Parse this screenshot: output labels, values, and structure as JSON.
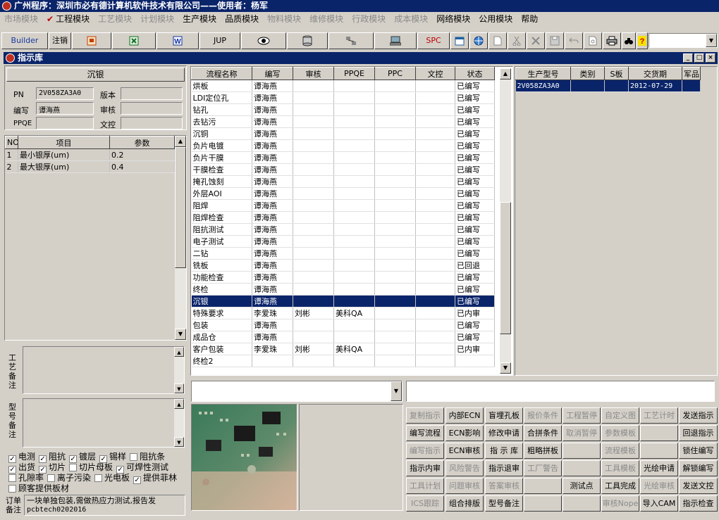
{
  "app": {
    "title": "广州程序：深圳市必有德计算机软件技术有限公司——使用者：杨军"
  },
  "menu": [
    {
      "label": "市场模块",
      "enabled": false
    },
    {
      "label": "✔ 工程模块",
      "enabled": true
    },
    {
      "label": "工艺模块",
      "enabled": false
    },
    {
      "label": "计划模块",
      "enabled": false
    },
    {
      "label": "生产模块",
      "enabled": true
    },
    {
      "label": "品质模块",
      "enabled": true
    },
    {
      "label": "物料模块",
      "enabled": false
    },
    {
      "label": "维修模块",
      "enabled": false
    },
    {
      "label": "行政模块",
      "enabled": false
    },
    {
      "label": "成本模块",
      "enabled": false
    },
    {
      "label": "网络模块",
      "enabled": true
    },
    {
      "label": "公用模块",
      "enabled": true
    },
    {
      "label": "帮助",
      "enabled": true
    }
  ],
  "toolbar": {
    "builder": "Builder",
    "logout": "注销",
    "jup": "JUP",
    "spc": "SPC"
  },
  "child_window": {
    "title": "指示库"
  },
  "left": {
    "header": "沉银",
    "pn_label": "PN",
    "pn_value": "2V058ZA3A0",
    "version_label": "版本",
    "version_value": "",
    "author_label": "编写",
    "author_value": "谭海燕",
    "review_label": "审核",
    "review_value": "",
    "ppqe_label": "PPQE",
    "ppqe_value": "",
    "control_label": "文控",
    "control_value": ""
  },
  "param_table": {
    "headers": [
      "NO",
      "项目",
      "参数"
    ],
    "rows": [
      [
        "1",
        "最小银厚(um)",
        "0.2"
      ],
      [
        "2",
        "最大银厚(um)",
        "0.4"
      ]
    ]
  },
  "notes": {
    "process_label": "工艺备注",
    "model_label": "型号备注"
  },
  "checkboxes": [
    [
      {
        "label": "电测",
        "checked": true
      },
      {
        "label": "阻抗",
        "checked": true
      },
      {
        "label": "镀层",
        "checked": true
      },
      {
        "label": "锡样",
        "checked": true
      },
      {
        "label": "阻抗条",
        "checked": false
      }
    ],
    [
      {
        "label": "出货",
        "checked": true
      },
      {
        "label": "切片",
        "checked": true
      },
      {
        "label": "切片母板",
        "checked": false
      },
      {
        "label": "可焊性测试",
        "checked": true
      }
    ],
    [
      {
        "label": "孔隙率",
        "checked": false
      },
      {
        "label": "离子污染",
        "checked": false
      },
      {
        "label": "光电板",
        "checked": false
      },
      {
        "label": "提供菲林",
        "checked": true
      }
    ],
    [
      {
        "label": "顾客提供板材",
        "checked": false
      }
    ]
  ],
  "order_note": {
    "label": "订单备注",
    "line1": "一块单独包装,需做热应力测试,报告发",
    "line2": "pcbtech0202016"
  },
  "flow_table": {
    "headers": [
      "流程名称",
      "编写",
      "审核",
      "PPQE",
      "PPC",
      "文控",
      "状态"
    ],
    "selected_index": 19,
    "rows": [
      [
        "烘板",
        "谭海燕",
        "",
        "",
        "",
        "",
        "已编写"
      ],
      [
        "LDI定位孔",
        "谭海燕",
        "",
        "",
        "",
        "",
        "已编写"
      ],
      [
        "钻孔",
        "谭海燕",
        "",
        "",
        "",
        "",
        "已编写"
      ],
      [
        "去钻污",
        "谭海燕",
        "",
        "",
        "",
        "",
        "已编写"
      ],
      [
        "沉铜",
        "谭海燕",
        "",
        "",
        "",
        "",
        "已编写"
      ],
      [
        "负片电镀",
        "谭海燕",
        "",
        "",
        "",
        "",
        "已编写"
      ],
      [
        "负片干膜",
        "谭海燕",
        "",
        "",
        "",
        "",
        "已编写"
      ],
      [
        "干膜检查",
        "谭海燕",
        "",
        "",
        "",
        "",
        "已编写"
      ],
      [
        "掩孔蚀刻",
        "谭海燕",
        "",
        "",
        "",
        "",
        "已编写"
      ],
      [
        "外层AOI",
        "谭海燕",
        "",
        "",
        "",
        "",
        "已编写"
      ],
      [
        "阻焊",
        "谭海燕",
        "",
        "",
        "",
        "",
        "已编写"
      ],
      [
        "阻焊检查",
        "谭海燕",
        "",
        "",
        "",
        "",
        "已编写"
      ],
      [
        "阻抗测试",
        "谭海燕",
        "",
        "",
        "",
        "",
        "已编写"
      ],
      [
        "电子测试",
        "谭海燕",
        "",
        "",
        "",
        "",
        "已编写"
      ],
      [
        "二钻",
        "谭海燕",
        "",
        "",
        "",
        "",
        "已编写"
      ],
      [
        "铣板",
        "谭海燕",
        "",
        "",
        "",
        "",
        "已回退"
      ],
      [
        "功能检查",
        "谭海燕",
        "",
        "",
        "",
        "",
        "已编写"
      ],
      [
        "终检",
        "谭海燕",
        "",
        "",
        "",
        "",
        "已编写"
      ],
      [
        "沉银",
        "谭海燕",
        "",
        "",
        "",
        "",
        "已编写"
      ],
      [
        "特殊要求",
        "李爱珠",
        "刘彬",
        "美科QA",
        "",
        "",
        "已内审"
      ],
      [
        "包装",
        "谭海燕",
        "",
        "",
        "",
        "",
        "已编写"
      ],
      [
        "成品仓",
        "谭海燕",
        "",
        "",
        "",
        "",
        "已编写"
      ],
      [
        "客户包装",
        "李爱珠",
        "刘彬",
        "美科QA",
        "",
        "",
        "已内审"
      ],
      [
        "终检2",
        "",
        "",
        "",
        "",
        "",
        ""
      ]
    ]
  },
  "model_table": {
    "headers": [
      "生产型号",
      "类别",
      "S板",
      "交货期",
      "军品"
    ],
    "rows": [
      [
        "2V058ZA3A0",
        "",
        "",
        "2012-07-29",
        ""
      ]
    ]
  },
  "actions": [
    [
      {
        "label": "复制指示",
        "enabled": false
      },
      {
        "label": "内部ECN",
        "enabled": true
      },
      {
        "label": "盲埋孔板",
        "enabled": true
      },
      {
        "label": "报价条件",
        "enabled": false
      },
      {
        "label": "工程暂停",
        "enabled": false
      },
      {
        "label": "自定义图",
        "enabled": false
      },
      {
        "label": "工艺计时",
        "enabled": false
      },
      {
        "label": "发送指示",
        "enabled": true
      }
    ],
    [
      {
        "label": "编写流程",
        "enabled": true
      },
      {
        "label": "ECN影响",
        "enabled": true
      },
      {
        "label": "修改申请",
        "enabled": true
      },
      {
        "label": "合拼条件",
        "enabled": true
      },
      {
        "label": "取消暂停",
        "enabled": false
      },
      {
        "label": "参数模板",
        "enabled": false
      },
      {
        "label": "",
        "enabled": false
      },
      {
        "label": "回退指示",
        "enabled": true
      }
    ],
    [
      {
        "label": "编写指示",
        "enabled": false
      },
      {
        "label": "ECN审核",
        "enabled": true
      },
      {
        "label": "指 示 库",
        "enabled": true
      },
      {
        "label": "粗略拼板",
        "enabled": true
      },
      {
        "label": "",
        "enabled": false
      },
      {
        "label": "流程模板",
        "enabled": false
      },
      {
        "label": "",
        "enabled": false
      },
      {
        "label": "锁住编写",
        "enabled": true
      }
    ],
    [
      {
        "label": "指示内审",
        "enabled": true
      },
      {
        "label": "风险警告",
        "enabled": false
      },
      {
        "label": "指示退审",
        "enabled": true
      },
      {
        "label": "工厂警告",
        "enabled": false
      },
      {
        "label": "",
        "enabled": false
      },
      {
        "label": "工具模板",
        "enabled": false
      },
      {
        "label": "光绘申请",
        "enabled": true
      },
      {
        "label": "解锁编写",
        "enabled": true
      }
    ],
    [
      {
        "label": "工具计划",
        "enabled": false
      },
      {
        "label": "问题审核",
        "enabled": false
      },
      {
        "label": "答案审核",
        "enabled": false
      },
      {
        "label": "",
        "enabled": false
      },
      {
        "label": "测试点",
        "enabled": true
      },
      {
        "label": "工具完成",
        "enabled": true
      },
      {
        "label": "光绘审核",
        "enabled": false
      },
      {
        "label": "发送文控",
        "enabled": true
      }
    ],
    [
      {
        "label": "ICS跟踪",
        "enabled": false
      },
      {
        "label": "组合排版",
        "enabled": true
      },
      {
        "label": "型号备注",
        "enabled": true
      },
      {
        "label": "",
        "enabled": false
      },
      {
        "label": "",
        "enabled": false
      },
      {
        "label": "审核Nope",
        "enabled": false
      },
      {
        "label": "导入CAM",
        "enabled": true
      },
      {
        "label": "指示检查",
        "enabled": true
      }
    ]
  ],
  "colors": {
    "title_bg": "#0a246a",
    "window_bg": "#d4d0c8",
    "selection": "#0a246a",
    "disabled_text": "#8a8a8a"
  }
}
